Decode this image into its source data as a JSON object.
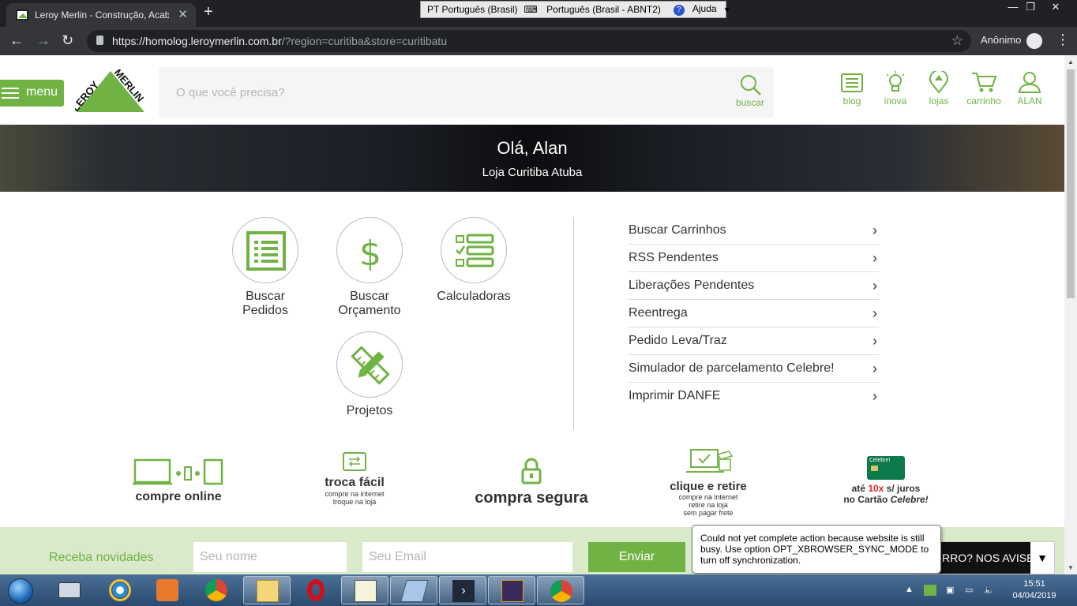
{
  "browser": {
    "tab_title": "Leroy Merlin - Construção, Acaba",
    "new_tab": "+",
    "url_main": "https://homolog.leroymerlin.com.br",
    "url_query": "/?region=curitiba&store=curitibatu",
    "incognito_label": "Anônimo",
    "language_bar": {
      "lang": "PT Português (Brasil)",
      "keyboard": "Português (Brasil - ABNT2)",
      "help": "Ajuda"
    }
  },
  "header": {
    "menu_label": "menu",
    "logo_text": "LEROY MERLIN",
    "search_placeholder": "O que você precisa?",
    "search_button": "buscar",
    "icons": [
      {
        "label": "blog",
        "icon": "blog-icon"
      },
      {
        "label": "inova",
        "icon": "bulb-icon"
      },
      {
        "label": "lojas",
        "icon": "store-pin-icon"
      },
      {
        "label": "carrinho",
        "icon": "cart-icon"
      },
      {
        "label": "ALAN",
        "icon": "user-icon"
      }
    ]
  },
  "banner": {
    "greeting": "Olá, Alan",
    "store": "Loja Curitiba Atuba"
  },
  "tiles": [
    {
      "label_1": "Buscar",
      "label_2": "Pedidos",
      "icon": "list-icon"
    },
    {
      "label_1": "Buscar",
      "label_2": "Orçamento",
      "icon": "dollar-icon"
    },
    {
      "label_1": "Calculadoras",
      "label_2": "",
      "icon": "checklist-icon"
    },
    {
      "label_1": "Projetos",
      "label_2": "",
      "icon": "pencil-ruler-icon"
    }
  ],
  "links": [
    "Buscar Carrinhos",
    "RSS Pendentes",
    "Liberações Pendentes",
    "Reentrega",
    "Pedido Leva/Traz",
    "Simulador de parcelamento Celebre!",
    "Imprimir DANFE"
  ],
  "features": {
    "online": "compre online",
    "troca_title": "troca fácil",
    "troca_sub1": "compre na internet",
    "troca_sub2": "troque na loja",
    "segura": "compra segura",
    "retire_title": "clique e retire",
    "retire_sub1": "compre na internet",
    "retire_sub2": "retire na loja",
    "retire_sub3": "sem pagar frete",
    "card_brand": "Celebre!",
    "card_line1_a": "até ",
    "card_line1_b": "10x",
    "card_line1_c": " s/ juros",
    "card_line2_a": "no Cartão ",
    "card_line2_b": "Celebre!"
  },
  "newsletter": {
    "label": "Receba novidades",
    "name_placeholder": "Seu nome",
    "email_placeholder": "Seu Email",
    "send": "Enviar",
    "error_button": "RRO? NOS AVISE!"
  },
  "tooltip": "Could not yet complete action because website is still busy. Use option OPT_XBROWSER_SYNC_MODE to turn off synchronization.",
  "taskbar": {
    "time": "15:51",
    "date": "04/04/2019"
  },
  "colors": {
    "brand_green": "#70b244",
    "newsletter_bg": "#d8eac9"
  }
}
